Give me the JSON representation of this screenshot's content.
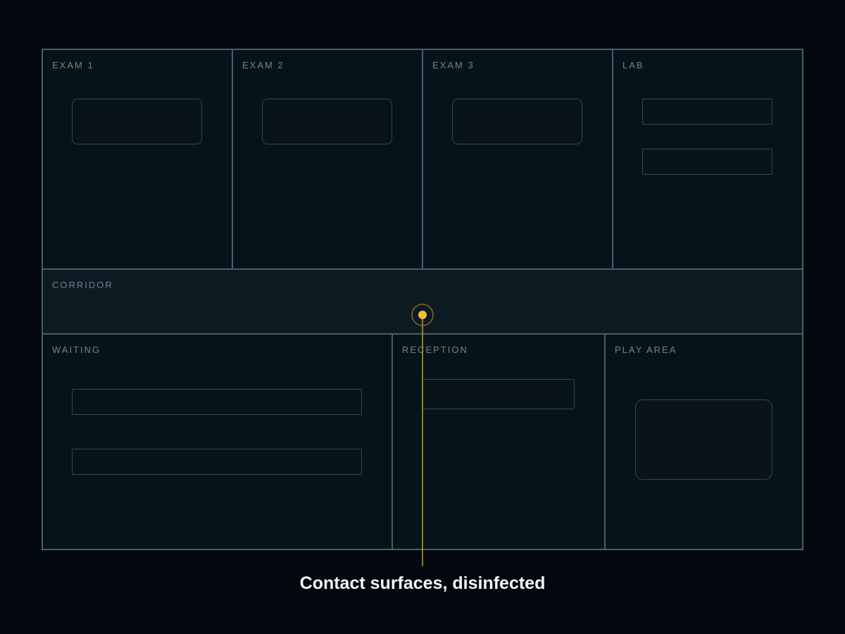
{
  "rooms": {
    "exam1": "EXAM 1",
    "exam2": "EXAM 2",
    "exam3": "EXAM 3",
    "lab": "LAB",
    "corridor": "CORRIDOR",
    "waiting": "WAITING",
    "reception": "RECEPTION",
    "play_area": "PLAY AREA"
  },
  "annotation": {
    "caption": "Contact surfaces, disinfected"
  },
  "colors": {
    "background": "#02080d",
    "room_fill": "#07131a",
    "corridor_fill": "#0c1a22",
    "wall": "#4a5e68",
    "furniture": "#34474f",
    "marker": "#f2c038",
    "label": "#6f838d",
    "caption": "#f4f6f8"
  }
}
